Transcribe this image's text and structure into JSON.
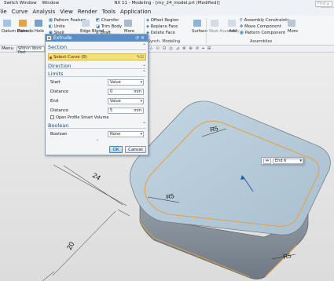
{
  "title_bar": {
    "quick_access": [
      "Switch Window",
      "Window"
    ],
    "title": "NX 11 - Modeling - [my_24_model.prt (Modified)]",
    "search_placeholder": "Find a Command"
  },
  "menu": [
    "File",
    "Curve",
    "Analysis",
    "View",
    "Render",
    "Tools",
    "Application"
  ],
  "ribbon": {
    "datum_plane": "Datum Plane",
    "extrude": "Extrude",
    "hole": "Hole",
    "more": "More",
    "pattern_feature": "Pattern Feature",
    "unite": "Unite",
    "shell": "Shell",
    "chamfer": "Chamfer",
    "trim_body": "Trim Body",
    "draft": "Draft",
    "edge_blend": "Edge Blend",
    "offset_region": "Offset Region",
    "replace_face": "Replace Face",
    "delete_face": "Delete Face",
    "sync_modeling": "Synch. Modeling",
    "surface": "Surface",
    "assembly_constraints": "Assembly Constraints",
    "move_component": "Move Component",
    "pattern_component": "Pattern Component",
    "assemblies": "Assemblies",
    "add": "Add",
    "new_assembly": "New Assembly",
    "more2": "More"
  },
  "toolbar2": {
    "menu": "Menu",
    "filter": "Within Work Part"
  },
  "dialog": {
    "title": "Extrude",
    "section_header": "Section",
    "select_curve": "Select Curve (0)",
    "direction_header": "Direction",
    "limits_header": "Limits",
    "start_label": "Start",
    "start_value": "Value",
    "distance_label": "Distance",
    "start_distance": "0",
    "unit": "mm",
    "end_label": "End",
    "end_value": "Value",
    "end_distance": "5",
    "open_profile": "Open Profile Smart Volume",
    "boolean_header": "Boolean",
    "boolean_label": "Boolean",
    "boolean_value": "None",
    "ok": "OK",
    "cancel": "Cancel"
  },
  "viewport": {
    "dimensions": [
      "24",
      "20",
      "R5",
      "R5",
      "R5"
    ]
  },
  "end_widget": {
    "value": "End 6"
  },
  "colors": {
    "dialog_header": "#5b8fc3",
    "highlight": "#f6e07a",
    "selection_edge": "#e8a03a",
    "top_face": "#b7ccd9",
    "side_face": "#8b949d"
  }
}
